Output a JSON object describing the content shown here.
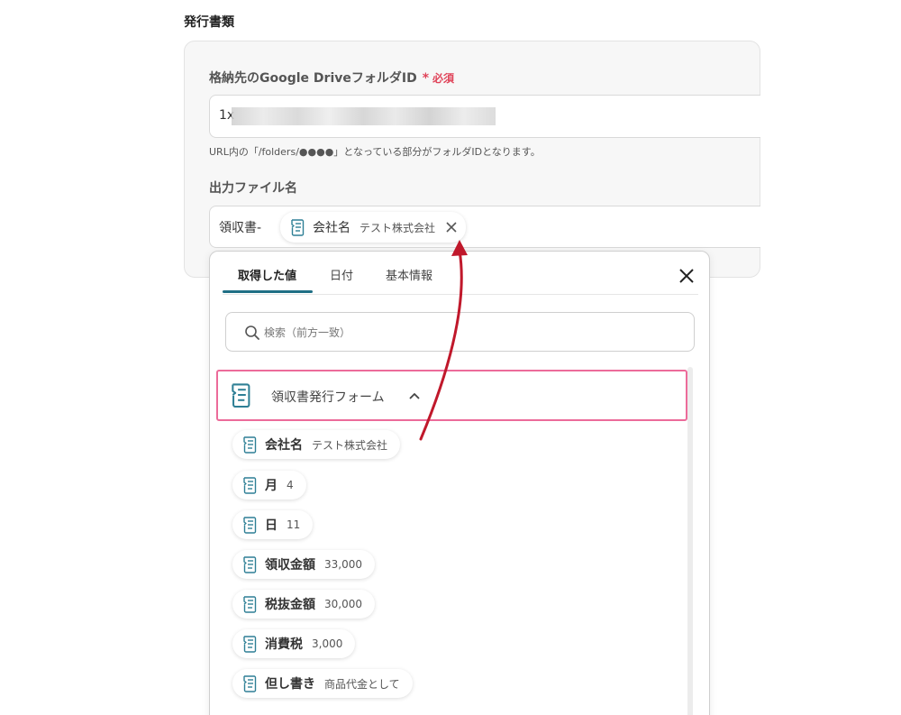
{
  "section_title": "発行書類",
  "folder_field": {
    "label": "格納先のGoogle DriveフォルダID",
    "required_star": "*",
    "required_text": "必須",
    "value_prefix": "1x",
    "hint": "URL内の「/folders/●●●●」となっている部分がフォルダIDとなります。"
  },
  "output_field": {
    "label": "出力ファイル名",
    "prefix": "領収書-",
    "chip": {
      "label": "会社名",
      "value": "テスト株式会社"
    }
  },
  "panel": {
    "tabs": [
      {
        "label": "取得した値"
      },
      {
        "label": "日付"
      },
      {
        "label": "基本情報"
      }
    ],
    "search_placeholder": "検索（前方一致）",
    "group_label": "領収書発行フォーム",
    "items": [
      {
        "label": "会社名",
        "value": "テスト株式会社"
      },
      {
        "label": "月",
        "value": "4"
      },
      {
        "label": "日",
        "value": "11"
      },
      {
        "label": "領収金額",
        "value": "33,000"
      },
      {
        "label": "税抜金額",
        "value": "30,000"
      },
      {
        "label": "消費税",
        "value": "3,000"
      },
      {
        "label": "但し書き",
        "value": "商品代金として"
      }
    ]
  },
  "colors": {
    "accent": "#1f6f85",
    "required": "#e0445a",
    "group_border": "#ec6b9a",
    "arrow": "#c0182b",
    "icon": "#2e7f95"
  },
  "icons": {
    "field_icon": "form-field-icon",
    "close": "close-icon",
    "search": "search-icon",
    "chevron": "chevron-up-icon"
  }
}
